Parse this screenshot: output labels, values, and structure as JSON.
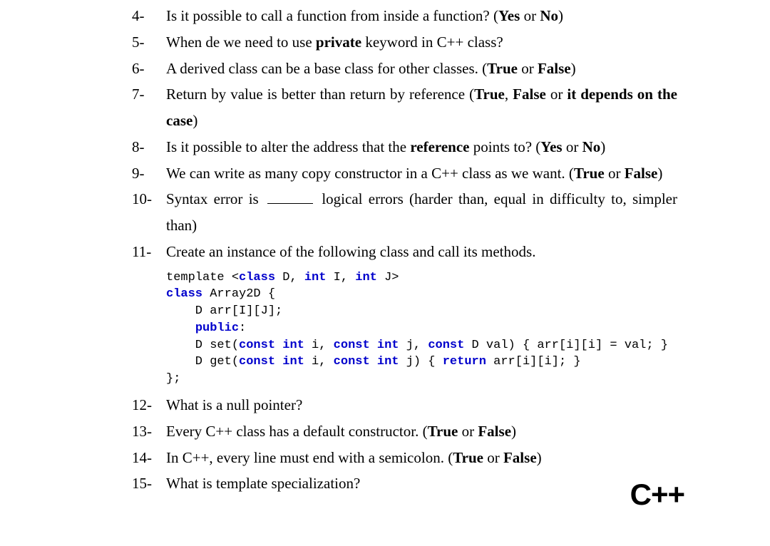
{
  "questions": [
    {
      "num": "4-",
      "html": "Is it possible to call a function from inside a function? (<b>Yes</b> or <b>No</b>)"
    },
    {
      "num": "5-",
      "html": "When de we need to use <b>private</b> keyword in C++ class?"
    },
    {
      "num": "6-",
      "html": "A derived class can be a base class for other classes. (<b>True</b> or <b>False</b>)"
    },
    {
      "num": "7-",
      "html": "Return by value is better than return by reference (<b>True</b>, <b>False</b> or <b>it depends on the case</b>)"
    },
    {
      "num": "8-",
      "html": " Is it possible to alter the address that the <b>reference</b> points to? (<b>Yes</b> or <b>No</b>)"
    },
    {
      "num": "9-",
      "html": " We can write as many copy constructor in a C++ class as we want. (<b>True</b> or <b>False</b>)"
    },
    {
      "num": "10-",
      "html": "Syntax error is <span class=\"blank\"></span> logical errors (harder than, equal in difficulty to, simpler than)"
    },
    {
      "num": "11-",
      "html": "Create an instance of the following class and call its methods."
    },
    {
      "num": "12-",
      "html": "What is a null pointer?"
    },
    {
      "num": "13-",
      "html": "Every C++ class has a default constructor. (<b>True</b> or <b>False</b>)"
    },
    {
      "num": "14-",
      "html": "In C++, every line must end with a semicolon. (<b>True</b> or <b>False</b>)"
    },
    {
      "num": "15-",
      "html": " What is template specialization?"
    }
  ],
  "code_html": "template &lt;<span class=\"kw\">class</span> D, <span class=\"kw\">int</span> I, <span class=\"kw\">int</span> J&gt;\n<span class=\"kw\">class</span> Array2D {\n    D arr[I][J];\n    <span class=\"kw\">public</span>:\n    D set(<span class=\"kw\">const</span> <span class=\"kw\">int</span> i, <span class=\"kw\">const</span> <span class=\"kw\">int</span> j, <span class=\"kw\">const</span> D val) { arr[i][i] = val; }\n    D get(<span class=\"kw\">const</span> <span class=\"kw\">int</span> i, <span class=\"kw\">const</span> <span class=\"kw\">int</span> j) { <span class=\"kw\">return</span> arr[i][i]; }\n};",
  "logo": "C++"
}
